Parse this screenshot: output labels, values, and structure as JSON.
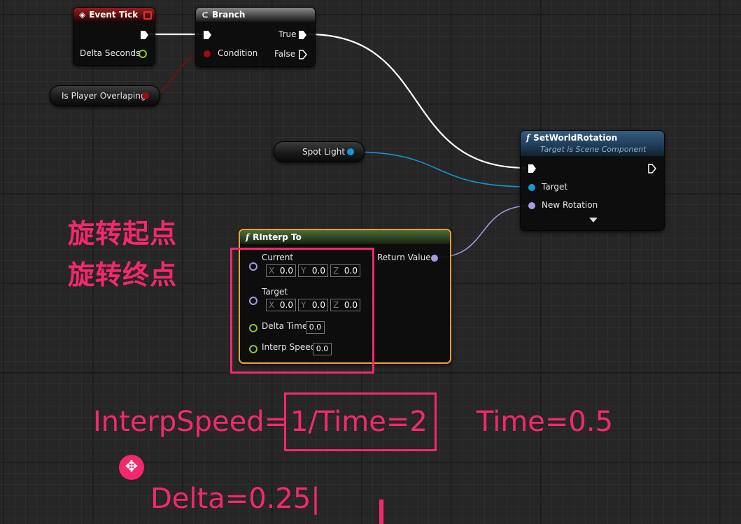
{
  "nodes": {
    "event_tick": {
      "title": "Event Tick",
      "delta_label": "Delta Seconds"
    },
    "branch": {
      "title": "Branch",
      "condition_label": "Condition",
      "true_label": "True",
      "false_label": "False"
    },
    "is_player_overlaping": {
      "label": "Is Player Overlaping"
    },
    "spot_light": {
      "label": "Spot Light"
    },
    "set_world_rotation": {
      "title": "SetWorldRotation",
      "subtitle": "Target is Scene Component",
      "target_label": "Target",
      "new_rotation_label": "New Rotation"
    },
    "rinterp_to": {
      "title": "RInterp To",
      "current_label": "Current",
      "target_label": "Target",
      "delta_time_label": "Delta Time",
      "interp_speed_label": "Interp Speed",
      "return_value_label": "Return Value",
      "axis_x": "X",
      "axis_y": "Y",
      "axis_z": "Z",
      "current": {
        "x": "0.0",
        "y": "0.0",
        "z": "0.0"
      },
      "target": {
        "x": "0.0",
        "y": "0.0",
        "z": "0.0"
      },
      "delta_time": "0.0",
      "interp_speed": "0.0"
    }
  },
  "annotations": {
    "line1": "旋转起点",
    "line2": "旋转终点",
    "interp_speed_prefix": "InterpSpeed=",
    "interp_speed_boxed": "1/Time=2",
    "time": "Time=0.5",
    "delta": "Delta=0.25|"
  },
  "colors": {
    "annotation": "#f4286f",
    "exec_wire": "#ffffff",
    "bool_pin": "#9b0e0e",
    "float_pin": "#8cc43c",
    "object_pin": "#119bd6",
    "rotator_pin": "#9b9bf5",
    "pure_function_border": "#f0a030"
  },
  "icons": {
    "event": "event-diamond-icon",
    "branch": "branch-icon",
    "function": "function-f-icon",
    "move": "move-cursor-icon"
  }
}
